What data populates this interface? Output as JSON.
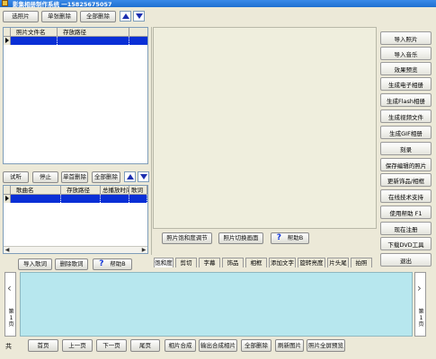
{
  "window": {
    "title": "影集相册制作系统    一15825675057"
  },
  "photo_toolbar": {
    "select_photos": "选照片",
    "delete_single": "单张删除",
    "delete_all": "全部删除"
  },
  "photo_grid": {
    "columns": [
      "照片文件名",
      "存放路径"
    ]
  },
  "audio_toolbar": {
    "listen": "试听",
    "stop": "停止",
    "delete_single": "单首删除",
    "delete_all": "全部删除"
  },
  "song_grid": {
    "columns": [
      "歌曲名",
      "存放路径",
      "总播放时间",
      "歌词"
    ]
  },
  "lyrics_toolbar": {
    "import_lyrics": "导入歌词",
    "delete_lyrics": "删除歌词",
    "help": "帮助B"
  },
  "preview_toolbar": {
    "saturation": "照片饱和度调节",
    "initial_screen": "照片切换画面",
    "help": "帮助B"
  },
  "right_menu": [
    "导入照片",
    "导入音乐",
    "效果预览",
    "生成电子相册",
    "生成Flash相册",
    "生成视频文件",
    "生成GIF相册",
    "刻录",
    "保存编辑的照片",
    "更新饰品/相框",
    "在线技术支持",
    "使用帮助  F1",
    "现在注册",
    "下载DVD工具",
    "退出"
  ],
  "effect_tabs": [
    "饱和度",
    "剪切",
    "字幕",
    "饰品",
    "相框",
    "添加文字",
    "旋转亮度",
    "片头尾",
    "拍照"
  ],
  "filmstrip": {
    "left_label": "第1页",
    "right_label": "第1页"
  },
  "bottom_nav": {
    "total": "共",
    "first": "首页",
    "prev": "上一页",
    "next": "下一页",
    "last": "尾页",
    "combine": "相片合成",
    "export": "输出合成相片",
    "delete_all": "全部删除",
    "refresh": "刷新图片",
    "fullscreen": "照片全屏预览"
  },
  "colors": {
    "title_bar": "#1f6fd0",
    "selection": "#0a2fd6",
    "preview_bg": "#efeedd",
    "filmstrip_bg": "#b7e7ee"
  }
}
